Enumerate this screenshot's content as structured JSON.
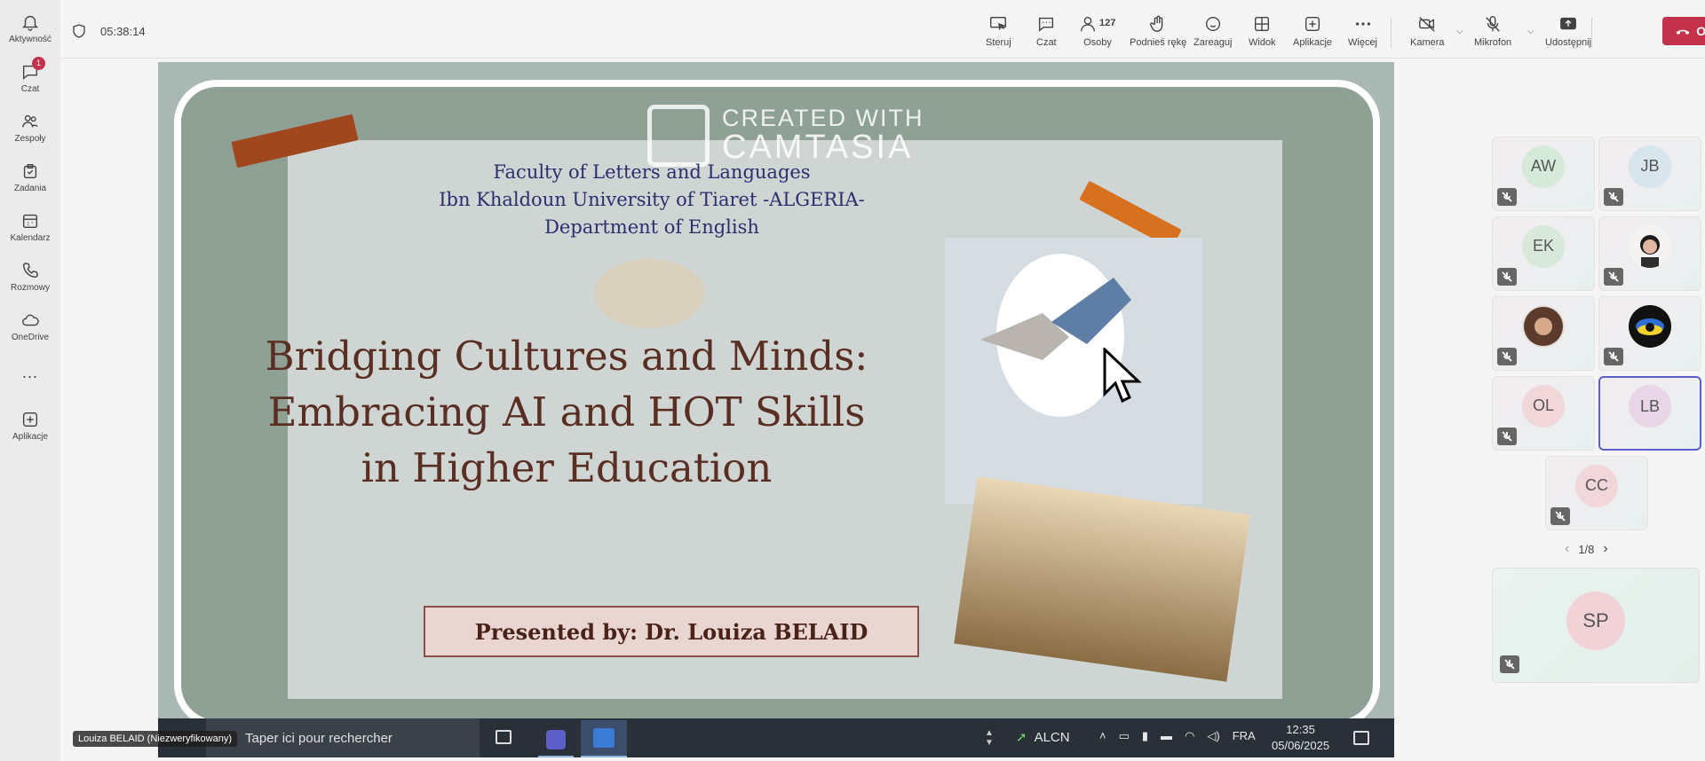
{
  "rail": {
    "items": [
      {
        "label": "Aktywność",
        "icon": "bell-icon"
      },
      {
        "label": "Czat",
        "icon": "chat-icon",
        "badge": "1"
      },
      {
        "label": "Zespoły",
        "icon": "teams-icon"
      },
      {
        "label": "Zadania",
        "icon": "tasks-icon"
      },
      {
        "label": "Kalendarz",
        "icon": "calendar-icon"
      },
      {
        "label": "Rozmowy",
        "icon": "phone-icon"
      },
      {
        "label": "OneDrive",
        "icon": "cloud-icon"
      },
      {
        "label": "...",
        "icon": "more-icon"
      },
      {
        "label": "Aplikacje",
        "icon": "plus-square-icon"
      }
    ]
  },
  "meeting": {
    "timer": "05:38:14",
    "people_count": "127",
    "controls": {
      "steruj": "Steruj",
      "czat": "Czat",
      "osoby": "Osoby",
      "raise_hand": "Podnieś rękę",
      "react": "Zareaguj",
      "view": "Widok",
      "apps": "Aplikacje",
      "more": "Więcej",
      "camera": "Kamera",
      "mic": "Mikrofon",
      "share": "Udostępnij",
      "leave": "Opuść"
    }
  },
  "slide": {
    "watermark_line1": "CREATED WITH",
    "watermark_line2": "CAMTASIA",
    "faculty": "Faculty of Letters and Languages",
    "university": "Ibn Khaldoun University of Tiaret -ALGERIA-",
    "department": "Department of English",
    "title_line1": "Bridging Cultures and Minds:",
    "title_line2": "Embracing AI and HOT Skills",
    "title_line3": "in Higher Education",
    "presented_by": "Presented by: Dr. Louiza BELAID"
  },
  "taskbar": {
    "search_placeholder": "Taper ici pour rechercher",
    "network": "ALCN",
    "language": "FRA",
    "time": "12:35",
    "date": "05/06/2025"
  },
  "presenter_tag": "Louiza BELAID (Niezweryfikowany)",
  "participants": [
    {
      "initials": "AW",
      "bg": "#d5ead9"
    },
    {
      "initials": "JB",
      "bg": "#d9e5ec"
    },
    {
      "initials": "EK",
      "bg": "#d8e9dc"
    },
    {
      "initials": "",
      "bg": "#e9e1e6"
    },
    {
      "initials": "",
      "bg": "#e4e7e3"
    },
    {
      "initials": "",
      "bg": "#dcebe4"
    },
    {
      "initials": "OL",
      "bg": "#f1d6da"
    },
    {
      "initials": "LB",
      "bg": "#e8d6e6"
    },
    {
      "initials": "CC",
      "bg": "#f1d6da"
    }
  ],
  "pager": "1/8",
  "spotlight": {
    "initials": "SP",
    "bg": "#f1d3d7"
  }
}
